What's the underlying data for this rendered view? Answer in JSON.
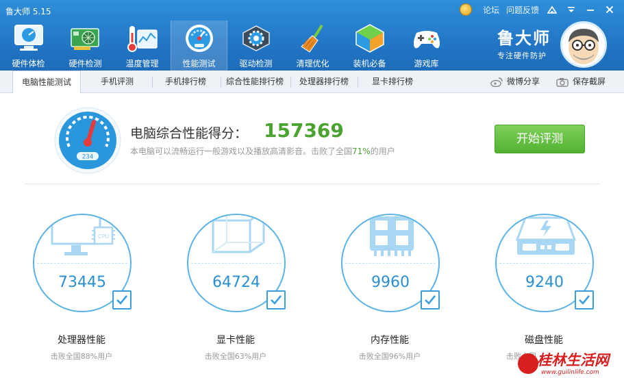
{
  "window": {
    "title": "鲁大师 5.15"
  },
  "top_links": {
    "forum": "论坛",
    "feedback": "问题反馈"
  },
  "nav": [
    {
      "label": "硬件体检",
      "icon": "monitor-icon"
    },
    {
      "label": "硬件检测",
      "icon": "graphics-card-icon"
    },
    {
      "label": "温度管理",
      "icon": "thermometer-icon"
    },
    {
      "label": "性能测试",
      "icon": "speedometer-icon"
    },
    {
      "label": "驱动检测",
      "icon": "driver-gear-icon"
    },
    {
      "label": "清理优化",
      "icon": "broom-icon"
    },
    {
      "label": "装机必备",
      "icon": "cube-icon"
    },
    {
      "label": "游戏库",
      "icon": "gamepad-icon"
    }
  ],
  "brand": {
    "name": "鲁大师",
    "slogan": "专注硬件防护"
  },
  "tabs": [
    {
      "label": "电脑性能测试"
    },
    {
      "label": "手机评测"
    },
    {
      "label": "手机排行榜"
    },
    {
      "label": "综合性能排行榜"
    },
    {
      "label": "处理器排行榜"
    },
    {
      "label": "显卡排行榜"
    }
  ],
  "tools": {
    "share": "微博分享",
    "screenshot": "保存截屏"
  },
  "score": {
    "gauge_reading": "234",
    "label": "电脑综合性能得分：",
    "value": "157369",
    "desc_before": "本电脑可以流畅运行一般游戏以及播放高清影音。击败了全国",
    "desc_pct": "71%",
    "desc_after": "的用户",
    "start_button": "开始评测"
  },
  "metrics": [
    {
      "value": "73445",
      "name": "处理器性能",
      "sub": "击败全国88%用户",
      "chip_label": "CPU"
    },
    {
      "value": "64724",
      "name": "显卡性能",
      "sub": "击败全国63%用户"
    },
    {
      "value": "9960",
      "name": "内存性能",
      "sub": "击败全国96%用户"
    },
    {
      "value": "9240",
      "name": "磁盘性能",
      "sub": "击败全国"
    }
  ],
  "watermark": {
    "name": "桂林生活网",
    "url": "www.guilinlife.com"
  },
  "colors": {
    "header": "#2277c6",
    "accent": "#2a8fd0",
    "score": "#4aa22f",
    "button": "#52b231"
  }
}
